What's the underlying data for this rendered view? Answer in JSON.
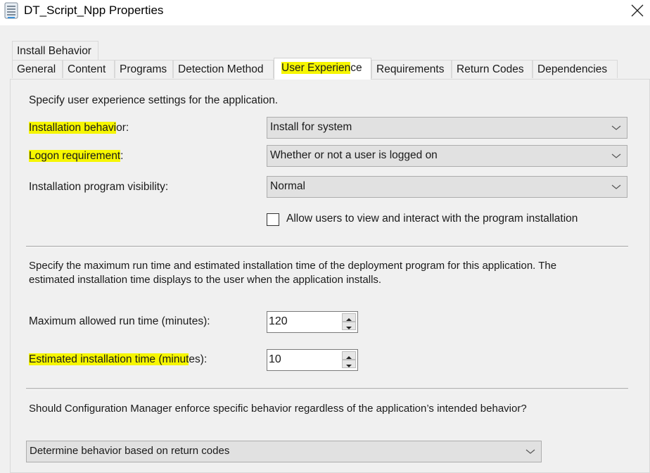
{
  "window": {
    "title": "DT_Script_Npp Properties",
    "icon": "properties-sheet-icon",
    "close_icon": "close-icon"
  },
  "tabs_row1": [
    {
      "label": "Install Behavior"
    }
  ],
  "tabs_row2": [
    {
      "label": "General",
      "active": false
    },
    {
      "label": "Content",
      "active": false
    },
    {
      "label": "Programs",
      "active": false
    },
    {
      "label": "Detection Method",
      "active": false
    },
    {
      "label": "User Experience",
      "active": true
    },
    {
      "label": "Requirements",
      "active": false
    },
    {
      "label": "Return Codes",
      "active": false
    },
    {
      "label": "Dependencies",
      "active": false
    }
  ],
  "active_tab_label": {
    "highlighted": "User Experien",
    "rest": "ce"
  },
  "section1": {
    "intro": "Specify user experience settings for the application.",
    "installation_behavior": {
      "label_highlighted": "Installation behavi",
      "label_rest": "or:",
      "value": "Install for system"
    },
    "logon_requirement": {
      "label_highlighted": "Logon requirement",
      "label_rest": ":",
      "value": "Whether or not a user is logged on"
    },
    "program_visibility": {
      "label": "Installation program visibility:",
      "value": "Normal"
    },
    "allow_interact": {
      "label": "Allow users to view and interact with the program installation",
      "checked": false
    }
  },
  "section2": {
    "intro_line1": "Specify the maximum run time and estimated installation time of the deployment program for this application. The",
    "intro_line2": "estimated installation time displays to the user when the application installs.",
    "max_run_time": {
      "label": "Maximum allowed run time (minutes):",
      "value": "120"
    },
    "estimated_time": {
      "label_highlighted": "Estimated installation time (minut",
      "label_rest": "es):",
      "value": "10"
    }
  },
  "section3": {
    "question": "Should Configuration Manager enforce specific behavior regardless of the application’s intended behavior?",
    "behavior_value": "Determine behavior based on return codes"
  },
  "colors": {
    "highlight": "#f6f600",
    "window_bg": "#f0f0f0",
    "titlebar_bg": "#ffffff"
  }
}
